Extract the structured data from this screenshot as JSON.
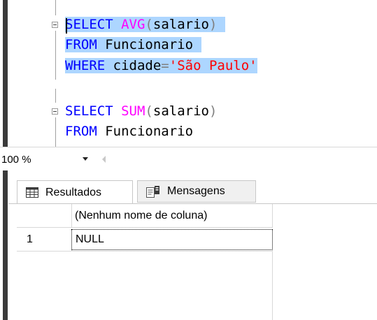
{
  "editor": {
    "query1": {
      "line1": {
        "kw": "SELECT",
        "fn": "AVG",
        "open": "(",
        "arg": "salario",
        "close": ")"
      },
      "line2": {
        "kw": "FROM",
        "table": "Funcionario"
      },
      "line3": {
        "kw": "WHERE",
        "col": "cidade",
        "op": "=",
        "str": "'São Paulo'"
      }
    },
    "query2": {
      "line1": {
        "kw": "SELECT",
        "fn": "SUM",
        "open": "(",
        "arg": "salario",
        "close": ")"
      },
      "line2": {
        "kw": "FROM",
        "table": "Funcionario"
      }
    }
  },
  "zoom": {
    "value": "100 %",
    "icon": "chevron-down-icon"
  },
  "tabs": {
    "results": {
      "label": "Resultados",
      "icon": "grid-icon"
    },
    "messages": {
      "label": "Mensagens",
      "icon": "messages-icon"
    }
  },
  "grid": {
    "columns": [
      "(Nenhum nome de coluna)"
    ],
    "rows": [
      {
        "number": "1",
        "cells": [
          "NULL"
        ]
      }
    ]
  },
  "colors": {
    "keyword": "#0000ff",
    "function": "#ff00ff",
    "string": "#ff0000",
    "operator": "#808080",
    "selection": "#add6ff"
  }
}
